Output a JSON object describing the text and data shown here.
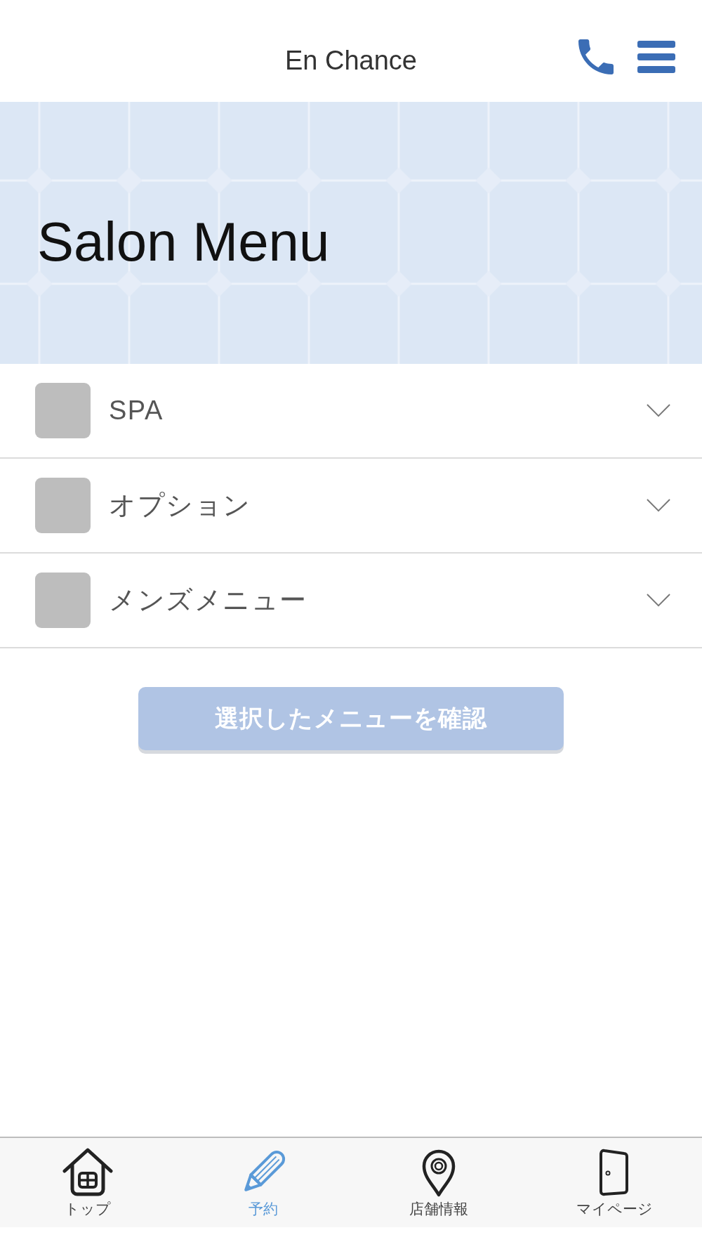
{
  "header": {
    "title": "En Chance"
  },
  "banner": {
    "title": "Salon Menu"
  },
  "categories": [
    {
      "label": "SPA",
      "expanded": false
    },
    {
      "label": "オプション",
      "expanded": false
    },
    {
      "label": "メンズメニュー",
      "expanded": false
    }
  ],
  "confirm_button": {
    "label": "選択したメニューを確認",
    "disabled": true
  },
  "tab_bar": [
    {
      "label": "トップ",
      "kind": "home",
      "selected": false
    },
    {
      "label": "予約",
      "kind": "reserve",
      "selected": true
    },
    {
      "label": "店舗情報",
      "kind": "shop",
      "selected": false
    },
    {
      "label": "マイページ",
      "kind": "mypage",
      "selected": false
    }
  ]
}
